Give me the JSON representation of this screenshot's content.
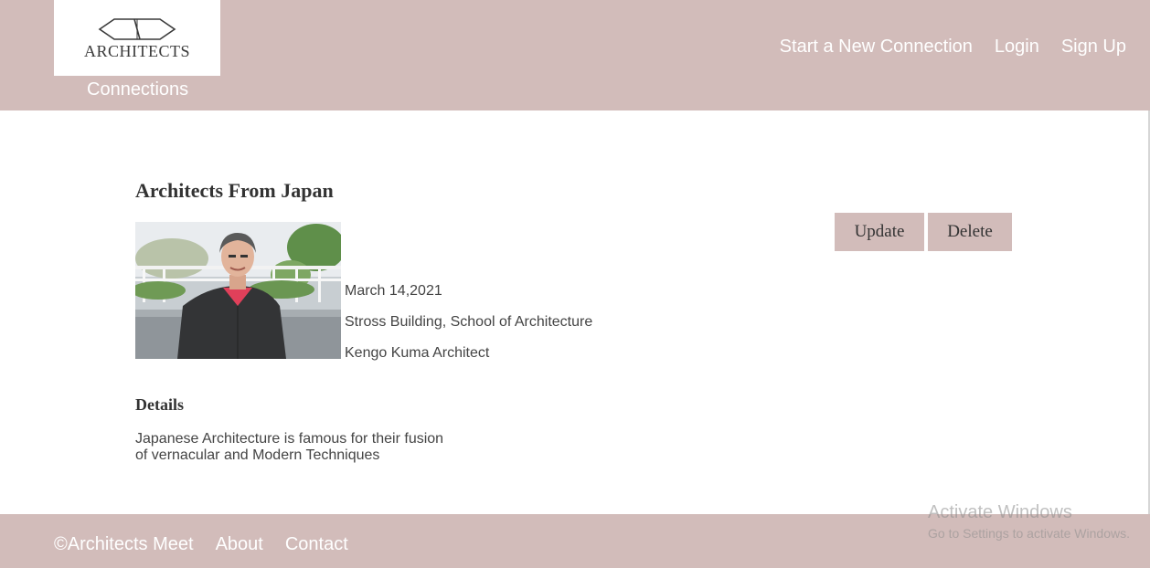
{
  "header": {
    "logo_text": "ARCHITECTS",
    "brand_subtitle": "Connections",
    "nav": {
      "new_connection": "Start a New Connection",
      "login": "Login",
      "signup": "Sign Up"
    }
  },
  "event": {
    "title": "Architects From Japan",
    "photo": "portrait-photo",
    "date": "March 14,2021",
    "location": "Stross Building, School of Architecture",
    "host": "Kengo Kuma Architect",
    "actions": {
      "update": "Update",
      "delete": "Delete"
    },
    "details_heading": "Details",
    "details_text": "Japanese Architecture is famous for their fusion of vernacular and Modern Techniques"
  },
  "footer": {
    "copyright": "©Architects Meet",
    "about": "About",
    "contact": "Contact"
  },
  "watermark": {
    "title": "Activate Windows",
    "subtitle": "Go to Settings to activate Windows."
  },
  "colors": {
    "brand": "#d2bcba",
    "text": "#333333"
  }
}
